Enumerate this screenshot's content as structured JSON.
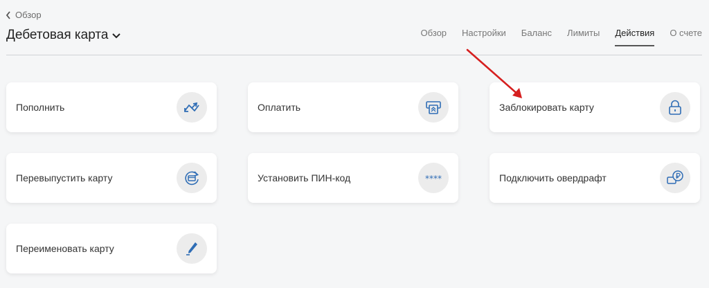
{
  "header": {
    "back_label": "Обзор",
    "title": "Дебетовая карта"
  },
  "tabs": [
    {
      "label": "Обзор",
      "active": false
    },
    {
      "label": "Настройки",
      "active": false
    },
    {
      "label": "Баланс",
      "active": false
    },
    {
      "label": "Лимиты",
      "active": false
    },
    {
      "label": "Действия",
      "active": true
    },
    {
      "label": "О счете",
      "active": false
    }
  ],
  "actions": [
    {
      "label": "Пополнить",
      "icon": "exchange-arrows-icon"
    },
    {
      "label": "Оплатить",
      "icon": "payment-terminal-icon"
    },
    {
      "label": "Заблокировать карту",
      "icon": "lock-icon"
    },
    {
      "label": "Перевыпустить карту",
      "icon": "card-reissue-icon"
    },
    {
      "label": "Установить ПИН-код",
      "icon": "pin-dots-icon"
    },
    {
      "label": "Подключить овердрафт",
      "icon": "overdraft-ruble-icon"
    },
    {
      "label": "Переименовать карту",
      "icon": "pen-icon"
    }
  ],
  "colors": {
    "icon_blue": "#2f6db5",
    "annotation_arrow": "#d61f1f"
  }
}
